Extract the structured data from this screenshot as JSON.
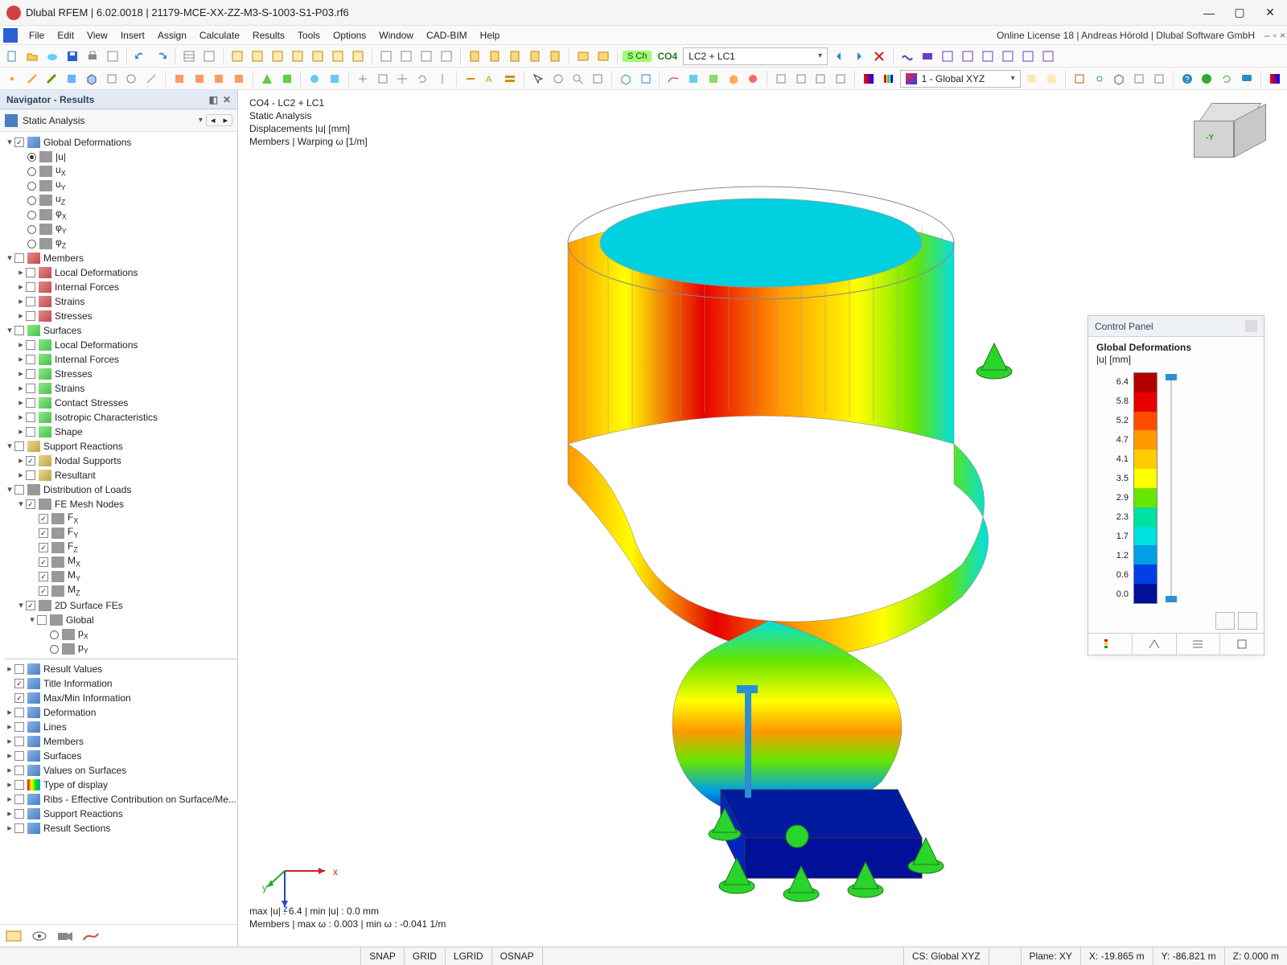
{
  "app": {
    "title": "Dlubal RFEM | 6.02.0018 | 21179-MCE-XX-ZZ-M3-S-1003-S1-P03.rf6",
    "license": "Online License 18 | Andreas Hörold | Dlubal Software GmbH"
  },
  "menu": {
    "items": [
      "File",
      "Edit",
      "View",
      "Insert",
      "Assign",
      "Calculate",
      "Results",
      "Tools",
      "Options",
      "Window",
      "CAD-BIM",
      "Help"
    ]
  },
  "toolbar": {
    "case_badge": "S Ch",
    "case_code": "CO4",
    "case_combo": "LC2 + LC1",
    "coord_system": "1 - Global XYZ"
  },
  "navigator": {
    "title": "Navigator - Results",
    "mode": "Static Analysis",
    "tree1": {
      "global_def": "Global Deformations",
      "u": "|u|",
      "ux": "uX",
      "uy": "uY",
      "uz": "uZ",
      "phix": "φX",
      "phiy": "φY",
      "phiz": "φZ",
      "members": "Members",
      "m_localdef": "Local Deformations",
      "m_intfor": "Internal Forces",
      "m_strains": "Strains",
      "m_stresses": "Stresses",
      "surfaces": "Surfaces",
      "s_localdef": "Local Deformations",
      "s_intfor": "Internal Forces",
      "s_stresses": "Stresses",
      "s_strains": "Strains",
      "s_contact": "Contact Stresses",
      "s_iso": "Isotropic Characteristics",
      "s_shape": "Shape",
      "suppreact": "Support Reactions",
      "nodalsupp": "Nodal Supports",
      "resultant": "Resultant",
      "distload": "Distribution of Loads",
      "femesh": "FE Mesh Nodes",
      "fx": "FX",
      "fy": "FY",
      "fz": "FZ",
      "mx": "MX",
      "my": "MY",
      "mz": "MZ",
      "surf2d": "2D Surface FEs",
      "global": "Global",
      "px": "pX",
      "py": "pY"
    },
    "tree2": {
      "resultvals": "Result Values",
      "titleinfo": "Title Information",
      "maxmin": "Max/Min Information",
      "deformation": "Deformation",
      "lines": "Lines",
      "members": "Members",
      "surfaces": "Surfaces",
      "valsonsurf": "Values on Surfaces",
      "typedisp": "Type of display",
      "ribs": "Ribs - Effective Contribution on Surface/Me...",
      "suppreact": "Support Reactions",
      "resultsect": "Result Sections"
    }
  },
  "work_overlay": {
    "l1": "CO4 - LC2 + LC1",
    "l2": "Static Analysis",
    "l3": "Displacements |u| [mm]",
    "l4": "Members | Warping ω [1/m]",
    "b1": "max |u| : 6.4 | min |u| : 0.0 mm",
    "b2": "Members | max ω : 0.003 | min ω : -0.041 1/m"
  },
  "axis": {
    "x": "x",
    "y": "y",
    "z": "z"
  },
  "navcube": {
    "y": "-Y"
  },
  "control_panel": {
    "header": "Control Panel",
    "title_a": "Global Deformations",
    "title_b": "|u| [mm]",
    "legend": {
      "values": [
        "6.4",
        "5.8",
        "5.2",
        "4.7",
        "4.1",
        "3.5",
        "2.9",
        "2.3",
        "1.7",
        "1.2",
        "0.6",
        "0.0"
      ],
      "colors": [
        "#b30000",
        "#e60000",
        "#ff4d00",
        "#ff9900",
        "#ffcc00",
        "#ffff00",
        "#66e600",
        "#00e0a0",
        "#00e0e0",
        "#009fe6",
        "#0040e6",
        "#001099"
      ]
    }
  },
  "statusbar": {
    "snap": "SNAP",
    "grid": "GRID",
    "lgrid": "LGRID",
    "osnap": "OSNAP",
    "cs": "CS: Global XYZ",
    "plane": "Plane: XY",
    "x": "X: -19.865 m",
    "y": "Y: -86.821 m",
    "z": "Z: 0.000 m"
  },
  "chart_data": {
    "type": "table",
    "title": "Global Deformations |u| [mm] color scale",
    "values": [
      6.4,
      5.8,
      5.2,
      4.7,
      4.1,
      3.5,
      2.9,
      2.3,
      1.7,
      1.2,
      0.6,
      0.0
    ],
    "colors": [
      "#b30000",
      "#e60000",
      "#ff4d00",
      "#ff9900",
      "#ffcc00",
      "#ffff00",
      "#66e600",
      "#00e0a0",
      "#00e0e0",
      "#009fe6",
      "#0040e6",
      "#001099"
    ],
    "summary": {
      "max_u_mm": 6.4,
      "min_u_mm": 0.0,
      "max_omega_1_per_m": 0.003,
      "min_omega_1_per_m": -0.041
    }
  }
}
